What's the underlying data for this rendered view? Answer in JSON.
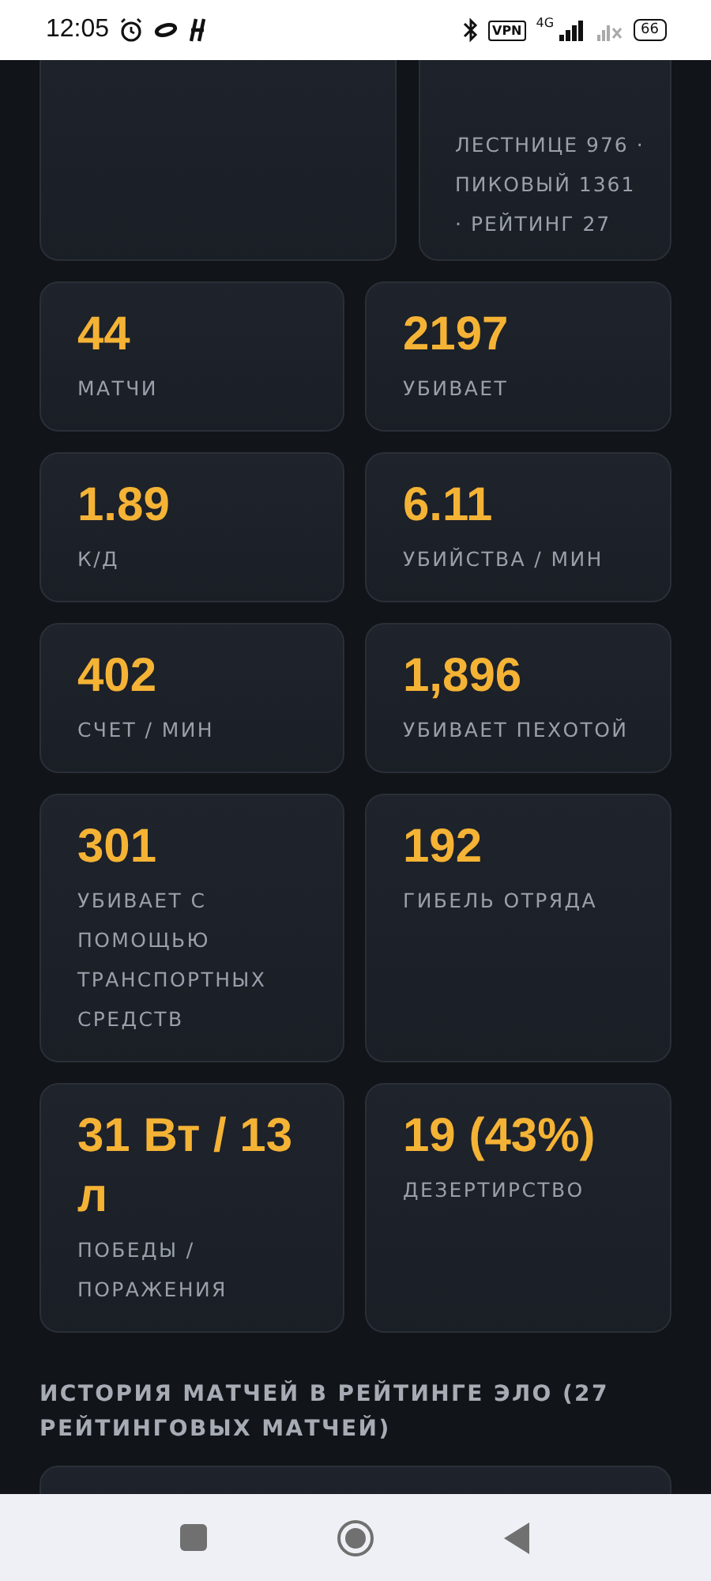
{
  "status_bar": {
    "time": "12:05",
    "vpn": "VPN",
    "network": "4G",
    "battery": "66"
  },
  "rating_card": {
    "text": "ЛЕСТНИЦЕ 976 · ПИКОВЫЙ 1361 · РЕЙТИНГ 27"
  },
  "stats": [
    {
      "value": "44",
      "label": "МАТЧИ"
    },
    {
      "value": "2197",
      "label": "УБИВАЕТ"
    },
    {
      "value": "1.89",
      "label": "К/Д"
    },
    {
      "value": "6.11",
      "label": "УБИЙСТВА / МИН"
    },
    {
      "value": "402",
      "label": "СЧЕТ / МИН"
    },
    {
      "value": "1,896",
      "label": "УБИВАЕТ ПЕХОТОЙ"
    },
    {
      "value": "301",
      "label": "УБИВАЕТ С ПОМОЩЬЮ ТРАНСПОРТНЫХ СРЕДСТВ"
    },
    {
      "value": "192",
      "label": "ГИБЕЛЬ ОТРЯДА"
    },
    {
      "value": "31 Вт / 13 л",
      "label": "ПОБЕДЫ / ПОРАЖЕНИЯ"
    },
    {
      "value": "19 (43%)",
      "label": "ДЕЗЕРТИРСТВО"
    }
  ],
  "history": {
    "title": "ИСТОРИЯ МАТЧЕЙ В РЕЙТИНГЕ ЭЛО (27 РЕЙТИНГОВЫХ МАТЧЕЙ)"
  }
}
